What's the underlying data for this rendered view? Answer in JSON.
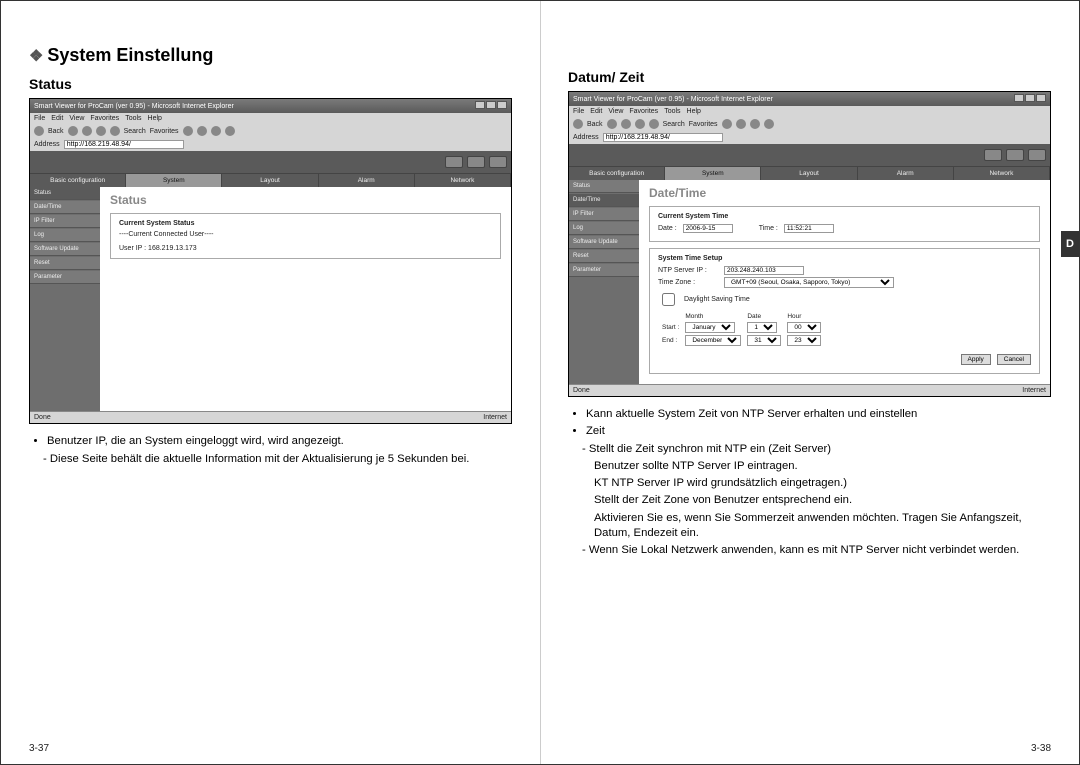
{
  "left": {
    "section_title": "System Einstellung",
    "sub_title": "Status",
    "browser": {
      "title": "Smart Viewer for ProCam (ver 0.95) - Microsoft Internet Explorer",
      "menus": [
        "File",
        "Edit",
        "View",
        "Favorites",
        "Tools",
        "Help"
      ],
      "toolbar_back": "Back",
      "toolbar_search": "Search",
      "toolbar_fav": "Favorites",
      "address_label": "Address",
      "address_value": "http://168.219.48.94/",
      "tabs": [
        "Basic configuration",
        "System",
        "Layout",
        "Alarm",
        "Network"
      ],
      "sidebar": [
        "Status",
        "Date/Time",
        "IP Filter",
        "Log",
        "Software Update",
        "Reset",
        "Parameter"
      ],
      "content_heading": "Status",
      "panel_title": "Current System Status",
      "panel_line1": "----Current Connected User----",
      "panel_line2": "User IP : 168.219.13.173",
      "status_left": "Done",
      "status_right": "Internet"
    },
    "bullets": [
      "Benutzer IP, die an System eingeloggt wird, wird angezeigt.",
      "- Diese Seite behält die aktuelle Information mit der Aktualisierung je 5 Sekunden bei."
    ],
    "page_no": "3-37"
  },
  "right": {
    "sub_title": "Datum/ Zeit",
    "browser": {
      "title": "Smart Viewer for ProCam (ver 0.95) - Microsoft Internet Explorer",
      "menus": [
        "File",
        "Edit",
        "View",
        "Favorites",
        "Tools",
        "Help"
      ],
      "toolbar_back": "Back",
      "toolbar_search": "Search",
      "toolbar_fav": "Favorites",
      "address_label": "Address",
      "address_value": "http://168.219.48.94/",
      "tabs": [
        "Basic configuration",
        "System",
        "Layout",
        "Alarm",
        "Network"
      ],
      "sidebar": [
        "Status",
        "Date/Time",
        "IP Filter",
        "Log",
        "Software Update",
        "Reset",
        "Parameter"
      ],
      "content_heading": "Date/Time",
      "panel1_title": "Current System Time",
      "panel1_date_label": "Date :",
      "panel1_date_value": "2006-9-15",
      "panel1_time_label": "Time :",
      "panel1_time_value": "11:52:21",
      "panel2_title": "System Time Setup",
      "ntp_label": "NTP Server IP :",
      "ntp_value": "203.248.240.103",
      "tz_label": "Time Zone :",
      "tz_value": "GMT+09 (Seoul, Osaka, Sapporo, Tokyo)",
      "dst_label": "Daylight Saving Time",
      "col_month": "Month",
      "col_date": "Date",
      "col_hour": "Hour",
      "row_start": "Start :",
      "row_end": "End :",
      "start_month": "January",
      "start_date": "1",
      "start_hour": "00",
      "end_month": "December",
      "end_date": "31",
      "end_hour": "23",
      "btn_apply": "Apply",
      "btn_cancel": "Cancel",
      "status_left": "Done",
      "status_right": "Internet"
    },
    "bullets": [
      "Kann aktuelle System Zeit von NTP Server erhalten und einstellen",
      "Zeit",
      "- Stellt die Zeit synchron mit NTP ein (Zeit Server)",
      "Benutzer sollte NTP Server IP eintragen.",
      "KT NTP Server IP wird grundsätzlich eingetragen.)",
      "Stellt der Zeit Zone von Benutzer entsprechend ein.",
      "Aktivieren Sie es, wenn Sie Sommerzeit anwenden möchten. Tragen Sie Anfangszeit, Datum, Endezeit ein.",
      "- Wenn Sie Lokal Netzwerk anwenden, kann es mit NTP Server nicht verbindet werden."
    ],
    "page_no": "3-38",
    "side_tab": "D"
  }
}
